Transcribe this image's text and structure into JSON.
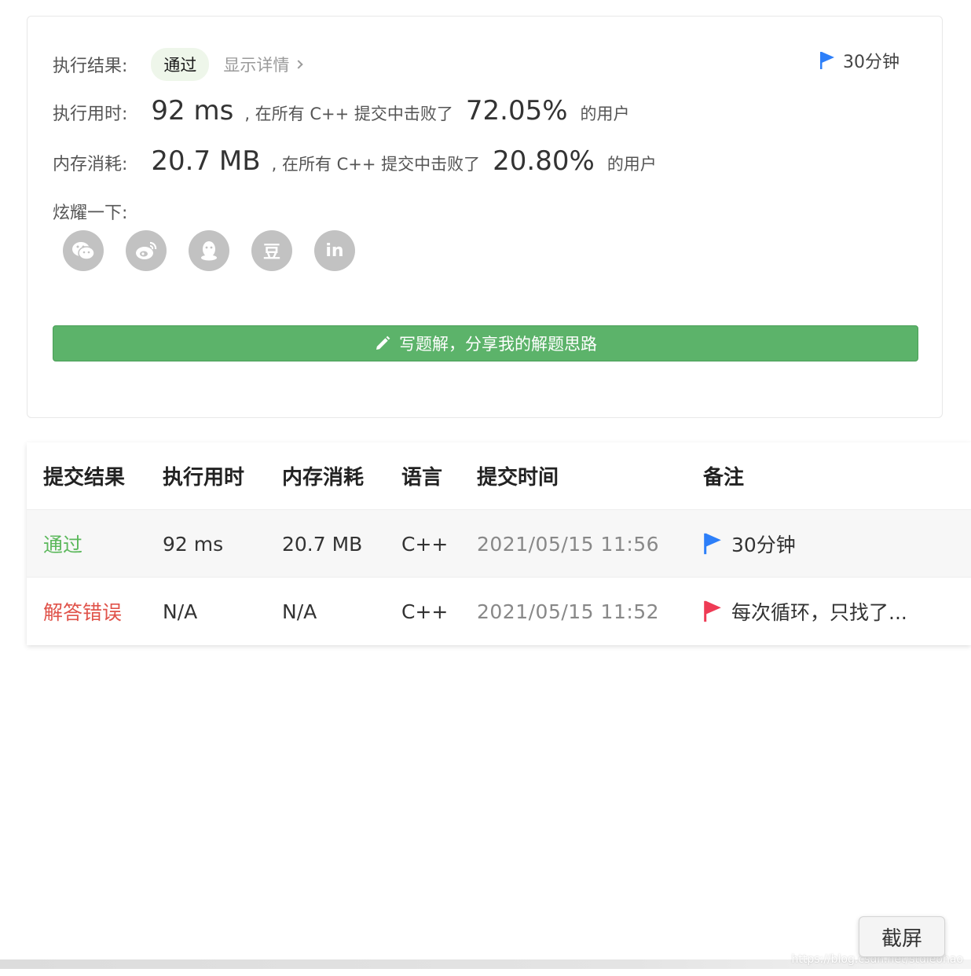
{
  "result": {
    "label": "执行结果:",
    "status": "通过",
    "details_link": "显示详情"
  },
  "tag": {
    "text": "30分钟",
    "flag_color": "#2d7ff9"
  },
  "runtime": {
    "label": "执行用时:",
    "value": "92 ms",
    "middle": ", 在所有 C++ 提交中击败了",
    "percent": "72.05%",
    "tail": "的用户"
  },
  "memory": {
    "label": "内存消耗:",
    "value": "20.7 MB",
    "middle": ", 在所有 C++ 提交中击败了",
    "percent": "20.80%",
    "tail": "的用户"
  },
  "share": {
    "label": "炫耀一下:",
    "icons": [
      "wechat-icon",
      "weibo-icon",
      "qq-icon",
      "douban-icon",
      "linkedin-icon"
    ],
    "douban_glyph": "豆",
    "linkedin_glyph": "in"
  },
  "solution_button": {
    "label": "写题解，分享我的解题思路",
    "color": "#5cb36a"
  },
  "table": {
    "headers": [
      "提交结果",
      "执行用时",
      "内存消耗",
      "语言",
      "提交时间",
      "备注"
    ],
    "rows": [
      {
        "status": "通过",
        "runtime": "92 ms",
        "memory": "20.7 MB",
        "lang": "C++",
        "time": "2021/05/15 11:56",
        "note": "30分钟",
        "flag_color": "#2d7ff9"
      },
      {
        "status": "解答错误",
        "runtime": "N/A",
        "memory": "N/A",
        "lang": "C++",
        "time": "2021/05/15 11:52",
        "note": "每次循环，只找了...",
        "flag_color": "#ee3b55"
      }
    ]
  },
  "capture_button": {
    "label": "截屏"
  },
  "watermark": "https://blog.csdn.net/stdleohao",
  "colors": {
    "pass": "#5cb85c",
    "fail": "#e0534a"
  }
}
